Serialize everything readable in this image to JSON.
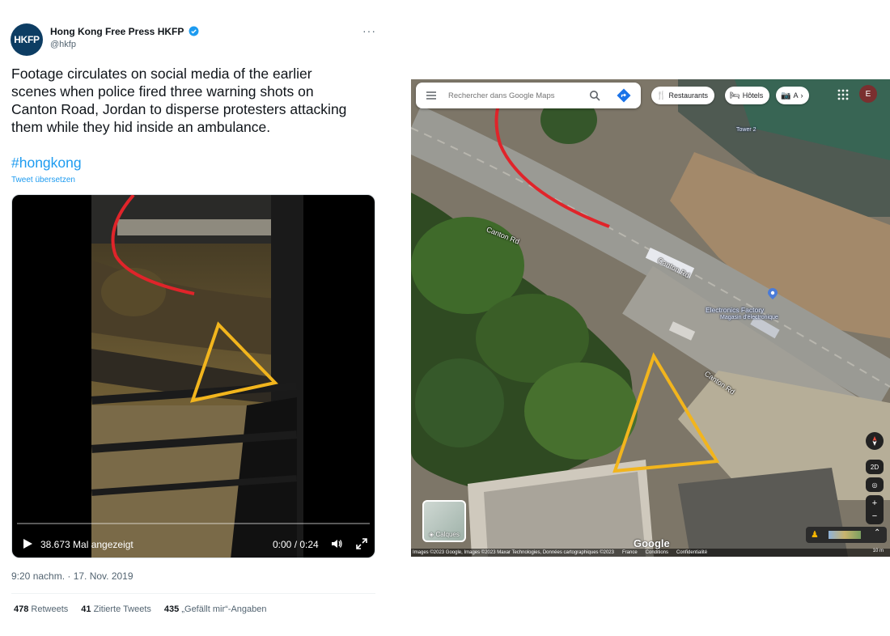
{
  "tweet": {
    "avatar_text": "HKFP",
    "display_name": "Hong Kong Free Press HKFP",
    "handle": "@hkfp",
    "text_lines": [
      "Footage circulates on social media of the earlier",
      "scenes when police fired three warning shots on",
      "Canton Road, Jordan to disperse protesters attacking",
      "them while they hid inside an ambulance."
    ],
    "hashtag": "#hongkong",
    "translate_link": "Tweet übersetzen",
    "video": {
      "views": "38.673 Mal angezeigt",
      "time": "0:00 / 0:24",
      "progress": 0
    },
    "timestamp": "9:20 nachm. · 17. Nov. 2019",
    "stats": {
      "retweets_count": "478",
      "retweets_label": "Retweets",
      "quotes_count": "41",
      "quotes_label": "Zitierte Tweets",
      "likes_count": "435",
      "likes_label": "„Gefällt mir“-Angaben"
    },
    "colors": {
      "link": "#1d9bf0",
      "brand": "#0d3d63"
    }
  },
  "map": {
    "search_placeholder": "Rechercher dans Google Maps",
    "chips": [
      {
        "icon": "restaurant-icon",
        "label": "Restaurants"
      },
      {
        "icon": "hotel-icon",
        "label": "Hôtels"
      },
      {
        "icon": "camera-icon",
        "label": "A"
      }
    ],
    "account_initial": "E",
    "road_labels": [
      "Canton Rd",
      "Canton Rd",
      "Canton Rd"
    ],
    "poi_name": "Electronics Factory",
    "poi_sub": "Magasin d'électronique",
    "tower_label": "Tower 2",
    "layers_label": "Calques",
    "google_logo": "Google",
    "attribution": "Images ©2023 Google, Images ©2023 Maxar Technologies, Données cartographiques ©2023",
    "footer_links": [
      "France",
      "Conditions",
      "Confidentialité"
    ],
    "scale": "10 m",
    "view_mode": "2D"
  }
}
